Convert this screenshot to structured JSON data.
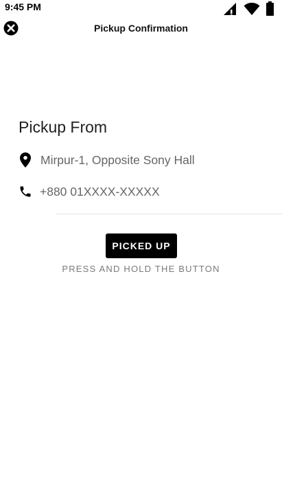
{
  "status_bar": {
    "time": "9:45 PM",
    "icons": [
      "cell-signal-icon",
      "wifi-icon",
      "battery-icon"
    ]
  },
  "app_bar": {
    "title": "Pickup Confirmation",
    "close_icon": "close-icon"
  },
  "pickup": {
    "section_title": "Pickup From",
    "address": "Mirpur-1, Opposite Sony Hall",
    "address_icon": "location-pin-icon",
    "phone": "+880 01XXXX-XXXXX",
    "phone_icon": "phone-icon"
  },
  "action": {
    "button_label": "PICKED UP",
    "hint": "PRESS AND HOLD THE BUTTON"
  }
}
